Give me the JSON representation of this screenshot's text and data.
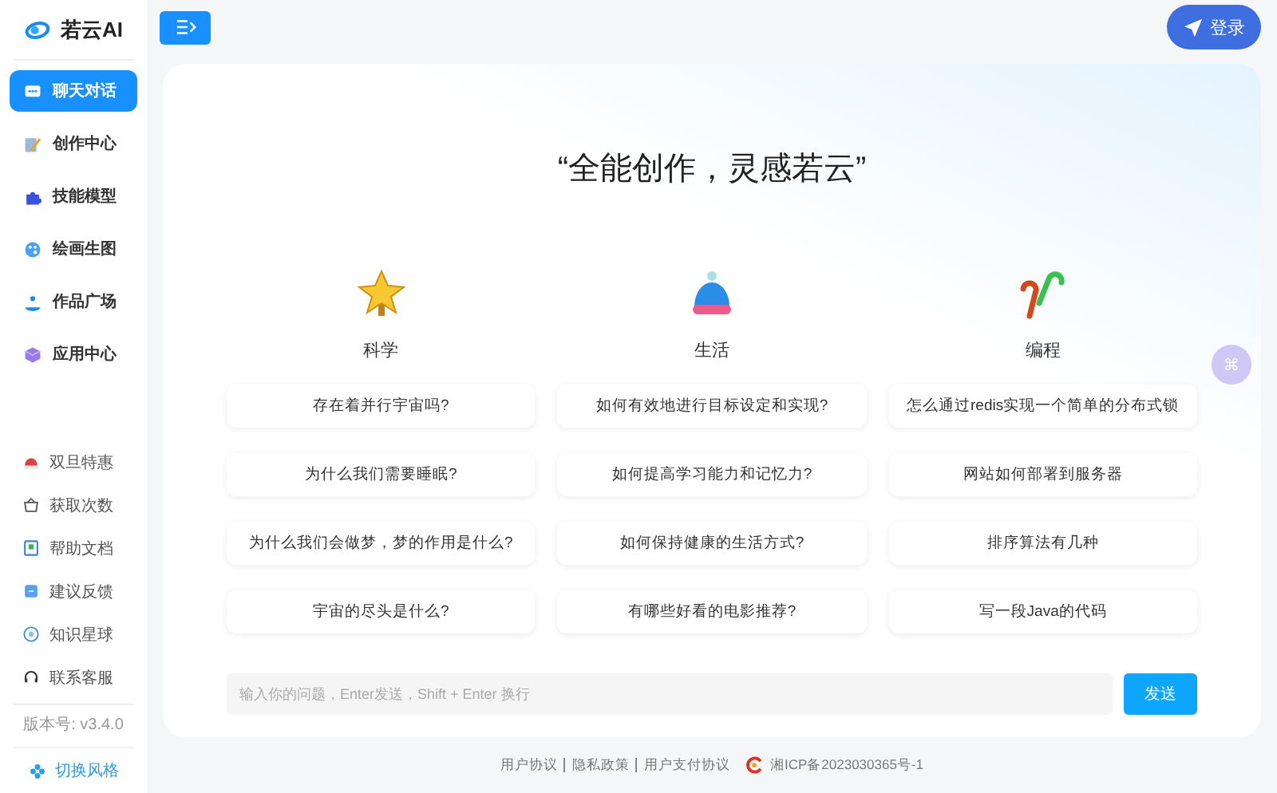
{
  "brand": {
    "name": "若云AI"
  },
  "nav": [
    {
      "label": "聊天对话",
      "selected": true
    },
    {
      "label": "创作中心",
      "selected": false
    },
    {
      "label": "技能模型",
      "selected": false
    },
    {
      "label": "绘画生图",
      "selected": false
    },
    {
      "label": "作品广场",
      "selected": false
    },
    {
      "label": "应用中心",
      "selected": false
    }
  ],
  "links": [
    {
      "label": "双旦特惠"
    },
    {
      "label": "获取次数"
    },
    {
      "label": "帮助文档"
    },
    {
      "label": "建议反馈"
    },
    {
      "label": "知识星球"
    },
    {
      "label": "联系客服"
    }
  ],
  "version": "版本号: v3.4.0",
  "theme_switch": "切换风格",
  "login": "登录",
  "heading": "“全能创作，灵感若云”",
  "float_button": "⌘",
  "categories": [
    {
      "title": "科学",
      "questions": [
        "存在着并行宇宙吗?",
        "为什么我们需要睡眠?",
        "为什么我们会做梦，梦的作用是什么?",
        "宇宙的尽头是什么?"
      ]
    },
    {
      "title": "生活",
      "questions": [
        "如何有效地进行目标设定和实现?",
        "如何提高学习能力和记忆力?",
        "如何保持健康的生活方式?",
        "有哪些好看的电影推荐?"
      ]
    },
    {
      "title": "编程",
      "questions": [
        "怎么通过redis实现一个简单的分布式锁",
        "网站如何部署到服务器",
        "排序算法有几种",
        "写一段Java的代码"
      ]
    }
  ],
  "input": {
    "placeholder": "输入你的问题，Enter发送，Shift + Enter 换行"
  },
  "send": "发送",
  "footer": {
    "links": [
      "用户协议",
      "隐私政策",
      "用户支付协议"
    ],
    "icp": "湘ICP备2023030365号-1"
  }
}
